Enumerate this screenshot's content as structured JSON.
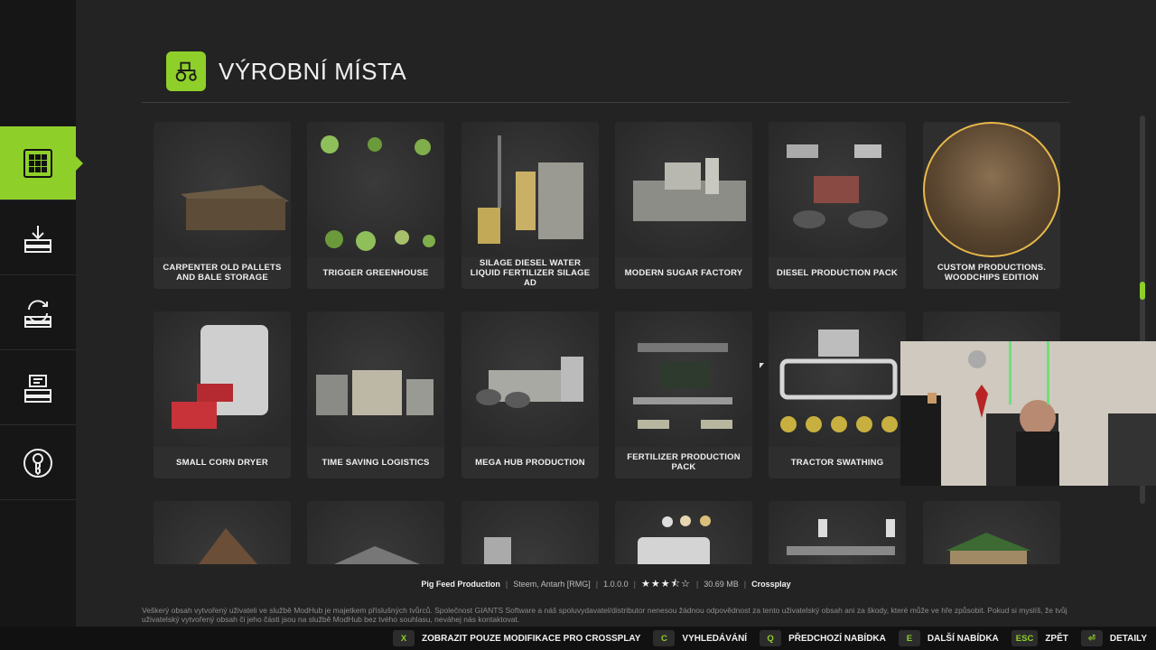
{
  "header": {
    "title": "VÝROBNÍ MÍSTA",
    "icon": "tractor-icon"
  },
  "sidebar": {
    "items": [
      {
        "id": "grid",
        "icon": "grid-icon",
        "active": true
      },
      {
        "id": "download",
        "icon": "download-icon",
        "active": false
      },
      {
        "id": "update",
        "icon": "update-icon",
        "active": false
      },
      {
        "id": "installed",
        "icon": "installed-icon",
        "active": false
      },
      {
        "id": "key",
        "icon": "key-icon",
        "active": false
      }
    ]
  },
  "cards": [
    {
      "label": "CARPENTER OLD PALLETS AND BALE STORAGE"
    },
    {
      "label": "TRIGGER GREENHOUSE"
    },
    {
      "label": "SILAGE DIESEL WATER LIQUID FERTILIZER SILAGE AD"
    },
    {
      "label": "MODERN SUGAR FACTORY"
    },
    {
      "label": "DIESEL PRODUCTION PACK"
    },
    {
      "label": "CUSTOM PRODUCTIONS. WOODCHIPS EDITION"
    },
    {
      "label": "SMALL CORN DRYER"
    },
    {
      "label": "TIME SAVING LOGISTICS"
    },
    {
      "label": "MEGA HUB PRODUCTION"
    },
    {
      "label": "FERTILIZER PRODUCTION PACK"
    },
    {
      "label": "TRACTOR SWATHING"
    },
    {
      "label": ""
    },
    {
      "label": ""
    },
    {
      "label": ""
    },
    {
      "label": ""
    },
    {
      "label": ""
    },
    {
      "label": ""
    },
    {
      "label": ""
    }
  ],
  "info": {
    "name": "Pig Feed Production",
    "author": "Steem, Antarh [RMG]",
    "version": "1.0.0.0",
    "rating": 3.5,
    "size": "30.69 MB",
    "crossplay": "Crossplay"
  },
  "disclaimer": "Veškerý obsah vytvořený uživateli ve službě ModHub je majetkem příslušných tvůrců. Společnost GIANTS Software a náš spoluvydavatel/distributor nenesou žádnou odpovědnost za tento uživatelský obsah ani za škody, které může ve hře způsobit. Pokud si myslíš, že tvůj uživatelský vytvořený obsah či jeho části jsou na službě ModHub bez tvého souhlasu, neváhej nás kontaktovat.",
  "bottom_hints": [
    {
      "key": "X",
      "label": "ZOBRAZIT POUZE MODIFIKACE PRO CROSSPLAY"
    },
    {
      "key": "C",
      "label": "VYHLEDÁVÁNÍ"
    },
    {
      "key": "Q",
      "label": "PŘEDCHOZÍ NABÍDKA"
    },
    {
      "key": "E",
      "label": "DALŠÍ NABÍDKA"
    },
    {
      "key": "ESC",
      "label": "ZPĚT"
    },
    {
      "key": "⏎",
      "label": "DETAILY"
    }
  ],
  "colors": {
    "accent": "#8fcf2a",
    "highlight_ring": "#e8b84a"
  }
}
